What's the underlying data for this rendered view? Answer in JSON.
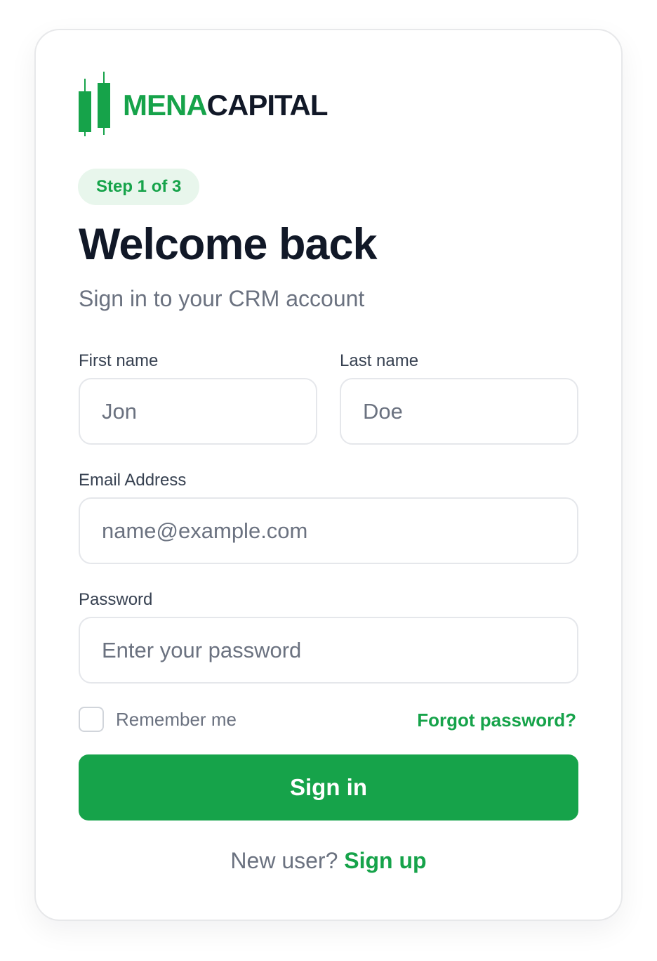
{
  "brand": {
    "name_part1": "MENA",
    "name_part2": "CAPITAL",
    "green": "#16a34a",
    "dark": "#111827"
  },
  "step_badge": "Step 1 of 3",
  "title": "Welcome back",
  "subtitle": "Sign in to your CRM account",
  "form": {
    "first_name": {
      "label": "First name",
      "value": "",
      "placeholder": "Jon"
    },
    "last_name": {
      "label": "Last name",
      "value": "",
      "placeholder": "Doe"
    },
    "email": {
      "label": "Email Address",
      "value": "",
      "placeholder": "name@example.com"
    },
    "password": {
      "label": "Password",
      "value": "",
      "placeholder": "Enter your password"
    },
    "remember_label": "Remember me",
    "remember_checked": false,
    "forgot_link": "Forgot password?",
    "submit_label": "Sign in"
  },
  "footer": {
    "prompt": "New user?",
    "signup_link": "Sign up"
  },
  "icons": {
    "logo": "candlestick-chart-icon"
  }
}
